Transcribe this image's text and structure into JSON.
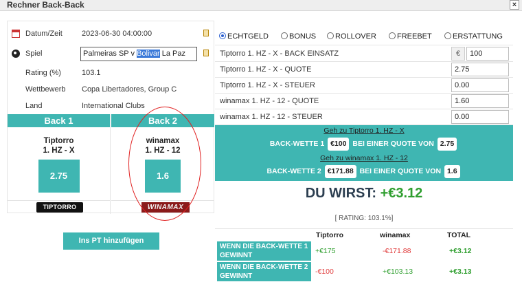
{
  "window": {
    "title": "Rechner Back-Back",
    "close_label": "×"
  },
  "info": {
    "date_label": "Datum/Zeit",
    "date_value": "2023-06-30 04:00:00",
    "match_label": "Spiel",
    "match_before": "Palmeiras SP v ",
    "match_selected": "Bolivar",
    "match_after": " La Paz",
    "rating_label": "Rating (%)",
    "rating_value": "103.1",
    "competition_label": "Wettbewerb",
    "competition_value": "Copa Libertadores, Group C",
    "country_label": "Land",
    "country_value": "International Clubs"
  },
  "back1": {
    "header": "Back 1",
    "bookmaker": "Tiptorro",
    "market": "1. HZ - X",
    "odds": "2.75",
    "logo_text": "TIPTORRO"
  },
  "back2": {
    "header": "Back 2",
    "bookmaker": "winamax",
    "market": "1. HZ - 12",
    "odds": "1.6",
    "logo_text": "WINAMAX"
  },
  "pt_button": "Ins PT hinzufügen",
  "radios": [
    {
      "label": "ECHTGELD",
      "selected": true
    },
    {
      "label": "BONUS",
      "selected": false
    },
    {
      "label": "ROLLOVER",
      "selected": false
    },
    {
      "label": "FREEBET",
      "selected": false
    },
    {
      "label": "ERSTATTUNG",
      "selected": false
    }
  ],
  "calc": {
    "row1_label": "Tiptorro 1. HZ - X - BACK EINSATZ",
    "currency": "€",
    "row1_value": "100",
    "row2_label": "Tiptorro 1. HZ - X - QUOTE",
    "row2_value": "2.75",
    "row3_label": "Tiptorro 1. HZ - X - STEUER",
    "row3_value": "0.00",
    "row4_label": "winamax 1. HZ - 12  - QUOTE",
    "row4_value": "1.60",
    "row5_label": "winamax 1. HZ - 12 - STEUER",
    "row5_value": "0.00"
  },
  "go1": {
    "link": "Geh zu Tiptorro 1. HZ - X",
    "pre": "BACK-WETTE 1",
    "stake": "€100",
    "mid": "BEI EINER QUOTE VON",
    "odds": "2.75"
  },
  "go2": {
    "link": "Geh zu winamax 1. HZ - 12",
    "pre": "BACK-WETTE 2",
    "stake": "€171.88",
    "mid": "BEI EINER QUOTE VON",
    "odds": "1.6"
  },
  "result": {
    "prefix": "DU WIRST: ",
    "amount": "+€3.12",
    "rating": "[ RATING: 103.1%]"
  },
  "summary": {
    "col1": "Tiptorro",
    "col2": "winamax",
    "col3": "TOTAL",
    "rows": [
      {
        "scenario": "WENN DIE BACK-WETTE 1 GEWINNT",
        "v1": "+€175",
        "v2": "-€171.88",
        "total": "+€3.12"
      },
      {
        "scenario": "WENN DIE BACK-WETTE 2 GEWINNT",
        "v1": "-€100",
        "v2": "+€103.13",
        "total": "+€3.13"
      }
    ]
  },
  "colors": {
    "teal": "#3fb6b2",
    "positive": "#2e9e2e",
    "negative": "#e03a3a",
    "annotation": "#e02020"
  }
}
